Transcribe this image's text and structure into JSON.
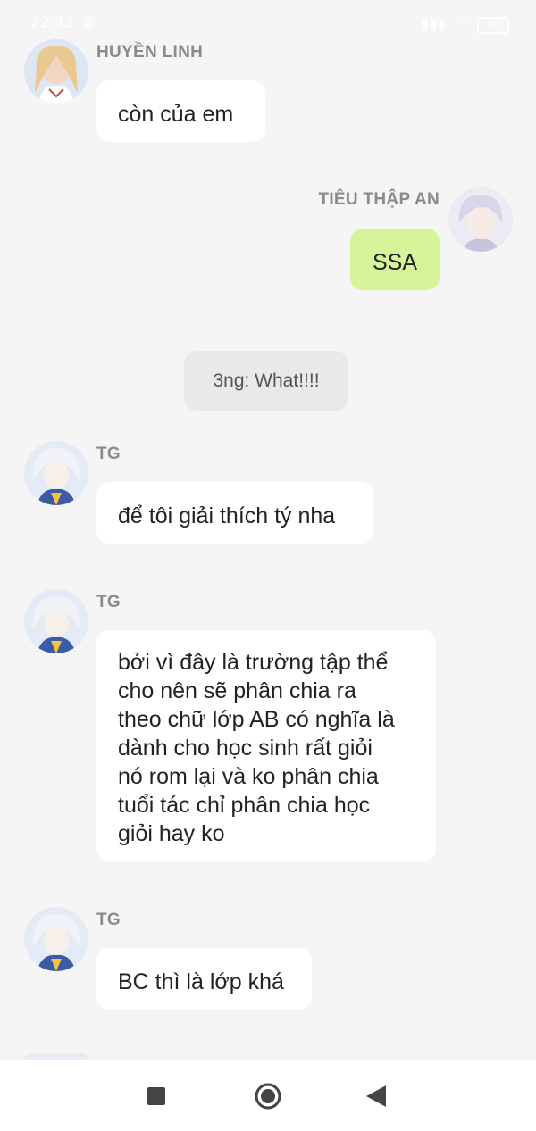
{
  "status_bar": {
    "time": "22:43",
    "battery": "58"
  },
  "messages": [
    {
      "sender": "HUYỀN LINH",
      "text": "còn của em",
      "side": "left",
      "avatar_icon": "girl-avatar"
    },
    {
      "sender": "TIÊU THẬP AN",
      "text": "SSA",
      "side": "right",
      "avatar_icon": "boy-avatar"
    },
    {
      "system": "3ng: What!!!!"
    },
    {
      "sender": "TG",
      "text": "để tôi giải thích tý nha",
      "side": "left",
      "avatar_icon": "tg-avatar"
    },
    {
      "sender": "TG",
      "text": "bởi vì đây là trường tập thể\ncho nên sẽ phân chia ra\ntheo chữ lớp AB có nghĩa là\ndành cho học sinh rất giỏi\nnó rom lại và ko phân chia\ntuổi tác chỉ phân chia học\ngiỏi hay ko",
      "side": "left",
      "avatar_icon": "tg-avatar"
    },
    {
      "sender": "TG",
      "text": "BC thì là lớp khá",
      "side": "left",
      "avatar_icon": "tg-avatar"
    }
  ],
  "colors": {
    "background": "#f5f5f5",
    "bubble_white": "#ffffff",
    "bubble_green": "#d6f59a",
    "sender_gray": "#8a8a8a"
  },
  "nav_bar": {
    "icons": [
      "recents-square-icon",
      "home-circle-icon",
      "back-triangle-icon"
    ]
  }
}
